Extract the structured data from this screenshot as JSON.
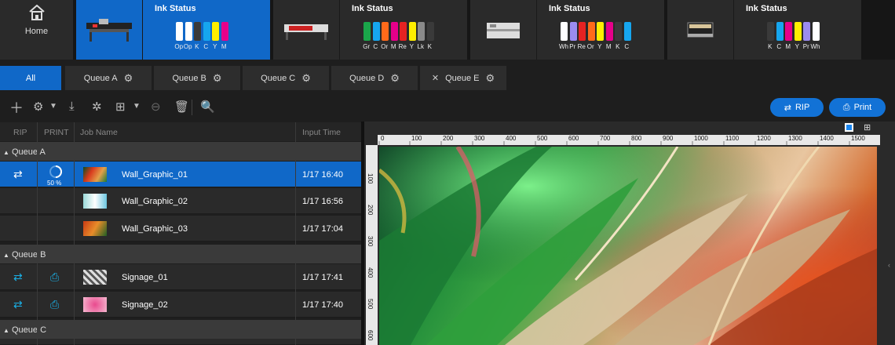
{
  "home": {
    "label": "Home"
  },
  "printers": [
    {
      "title": "Ink Status",
      "inks": [
        {
          "label": "Op",
          "color": "#ffffff"
        },
        {
          "label": "Op",
          "color": "#ffffff"
        },
        {
          "label": "K",
          "color": "#3a3a3a"
        },
        {
          "label": "C",
          "color": "#16a6ef"
        },
        {
          "label": "Y",
          "color": "#ffee00"
        },
        {
          "label": "M",
          "color": "#e6008a"
        }
      ]
    },
    {
      "title": "Ink Status",
      "inks": [
        {
          "label": "Gr",
          "color": "#1aa64a"
        },
        {
          "label": "C",
          "color": "#16a6ef"
        },
        {
          "label": "Or",
          "color": "#ff6a1a"
        },
        {
          "label": "M",
          "color": "#e6008a"
        },
        {
          "label": "Re",
          "color": "#e52222"
        },
        {
          "label": "Y",
          "color": "#ffee00"
        },
        {
          "label": "Lk",
          "color": "#8a8a8a"
        },
        {
          "label": "K",
          "color": "#3a3a3a"
        }
      ]
    },
    {
      "title": "Ink Status",
      "inks": [
        {
          "label": "Wh",
          "color": "#ffffff"
        },
        {
          "label": "Pr",
          "color": "#9b8cf0"
        },
        {
          "label": "Re",
          "color": "#e52222"
        },
        {
          "label": "Or",
          "color": "#ff6a1a"
        },
        {
          "label": "Y",
          "color": "#ffee00"
        },
        {
          "label": "M",
          "color": "#e6008a"
        },
        {
          "label": "K",
          "color": "#3a3a3a"
        },
        {
          "label": "C",
          "color": "#16a6ef"
        }
      ]
    },
    {
      "title": "Ink Status",
      "inks": [
        {
          "label": "K",
          "color": "#3a3a3a"
        },
        {
          "label": "C",
          "color": "#16a6ef"
        },
        {
          "label": "M",
          "color": "#e6008a"
        },
        {
          "label": "Y",
          "color": "#ffee00"
        },
        {
          "label": "Pr",
          "color": "#9b8cf0"
        },
        {
          "label": "Wh",
          "color": "#ffffff"
        }
      ]
    }
  ],
  "tabs": {
    "all": "All",
    "queue_a": "Queue A",
    "queue_b": "Queue B",
    "queue_c": "Queue C",
    "queue_d": "Queue D",
    "queue_e": "Queue E"
  },
  "buttons": {
    "rip": "RIP",
    "print": "Print"
  },
  "list": {
    "headers": {
      "rip": "RIP",
      "print": "PRINT",
      "job_name": "Job Name",
      "input_time": "Input Time"
    },
    "groups": {
      "a": "Queue A",
      "b": "Queue B",
      "c": "Queue C"
    },
    "progress": "50 %",
    "rows": [
      {
        "name": "Wall_Graphic_01",
        "time": "1/17 16:40"
      },
      {
        "name": "Wall_Graphic_02",
        "time": "1/17 16:56"
      },
      {
        "name": "Wall_Graphic_03",
        "time": "1/17 17:04"
      },
      {
        "name": "Signage_01",
        "time": "1/17 17:41"
      },
      {
        "name": "Signage_02",
        "time": "1/17 17:40"
      }
    ]
  },
  "ruler": {
    "h": [
      "0",
      "100",
      "200",
      "300",
      "400",
      "500",
      "600",
      "700",
      "800",
      "900",
      "1000",
      "1100",
      "1200",
      "1300",
      "1400",
      "1500"
    ],
    "v": [
      "100",
      "200",
      "300",
      "400",
      "500",
      "600"
    ]
  }
}
